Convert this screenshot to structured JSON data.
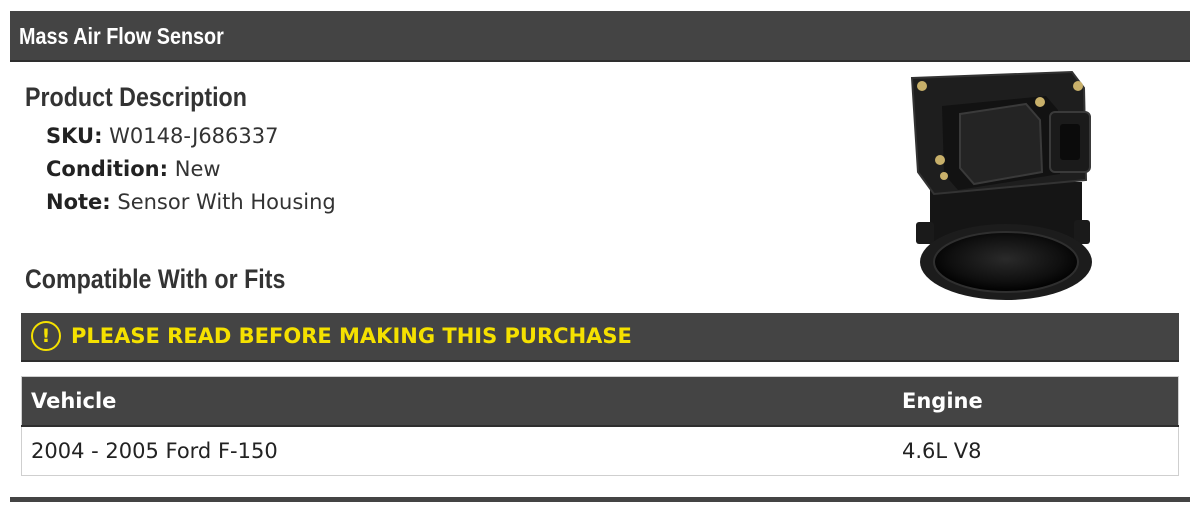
{
  "header": {
    "title": "Mass Air Flow Sensor"
  },
  "description": {
    "heading": "Product Description",
    "rows": [
      {
        "label": "SKU:",
        "value": "W0148-J686337"
      },
      {
        "label": "Condition:",
        "value": "New"
      },
      {
        "label": "Note:",
        "value": "Sensor With Housing"
      }
    ]
  },
  "compat": {
    "heading": "Compatible With or Fits",
    "warning": {
      "icon": "!",
      "text": "PLEASE READ BEFORE MAKING THIS PURCHASE"
    },
    "table": {
      "columns": [
        "Vehicle",
        "Engine"
      ],
      "rows": [
        [
          "2004 - 2005 Ford F-150",
          "4.6L V8"
        ]
      ]
    }
  },
  "product_image": {
    "icon": "mass-air-flow-sensor-image"
  },
  "colors": {
    "bar_background": "#444444",
    "warning_yellow": "#f5e100",
    "text": "#222222",
    "border": "#cfcfcf"
  }
}
